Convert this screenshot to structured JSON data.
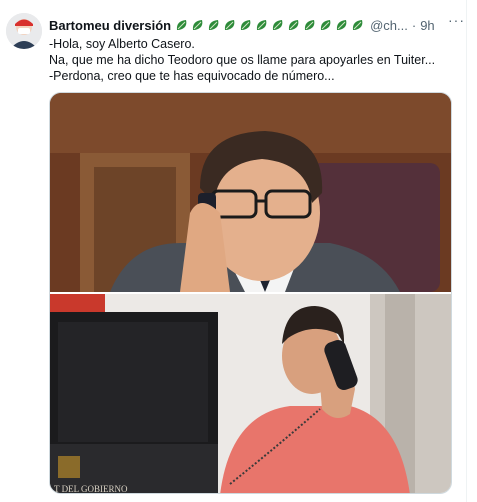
{
  "tweet": {
    "display_name": "Bartomeu diversión",
    "handle": "@ch...",
    "separator": "·",
    "time": "9h",
    "more_label": "···",
    "badge_count": 12,
    "badge_color": "#2e8b3a",
    "lines": [
      "-Hola, soy Alberto Casero.",
      "Na, que me ha dicho Teodoro que os llame para apoyarles en Tuiter...",
      "-Perdona, creo que te has equivocado de número..."
    ]
  },
  "media": {
    "top_photo": "man-in-parliament-on-phone",
    "bottom_photo": "man-in-pink-shirt-on-desk-phone",
    "bottom_caption": "T DEL GOBIERNO"
  }
}
